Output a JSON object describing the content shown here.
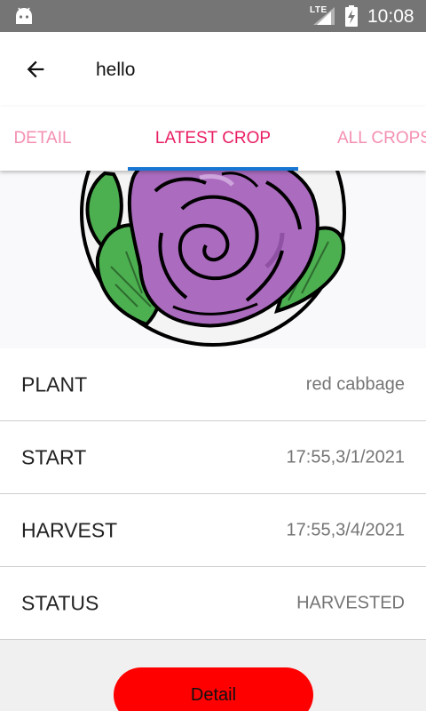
{
  "status_bar": {
    "network": "LTE",
    "time": "10:08",
    "icons": [
      "android-icon",
      "signal-icon",
      "battery-charging-icon"
    ]
  },
  "app_bar": {
    "title": "hello",
    "back_icon": "arrow-back-icon"
  },
  "tabs": [
    {
      "label": "DETAIL",
      "selected": false
    },
    {
      "label": "LATEST CROP",
      "selected": true
    },
    {
      "label": "ALL CROPS",
      "selected": false
    }
  ],
  "colors": {
    "tab_selected": "#e91e63",
    "tab_unselected": "#f48fb1",
    "tab_indicator": "#1976d2",
    "button": "#ff0000",
    "cabbage": "#ab6bbf",
    "leaf": "#4caf50"
  },
  "crop_image": "red-cabbage-illustration",
  "details": [
    {
      "label": "PLANT",
      "value": "red cabbage"
    },
    {
      "label": "START",
      "value": "17:55,3/1/2021"
    },
    {
      "label": "HARVEST",
      "value": "17:55,3/4/2021"
    },
    {
      "label": "STATUS",
      "value": "HARVESTED"
    }
  ],
  "button": {
    "label": "Detail"
  }
}
